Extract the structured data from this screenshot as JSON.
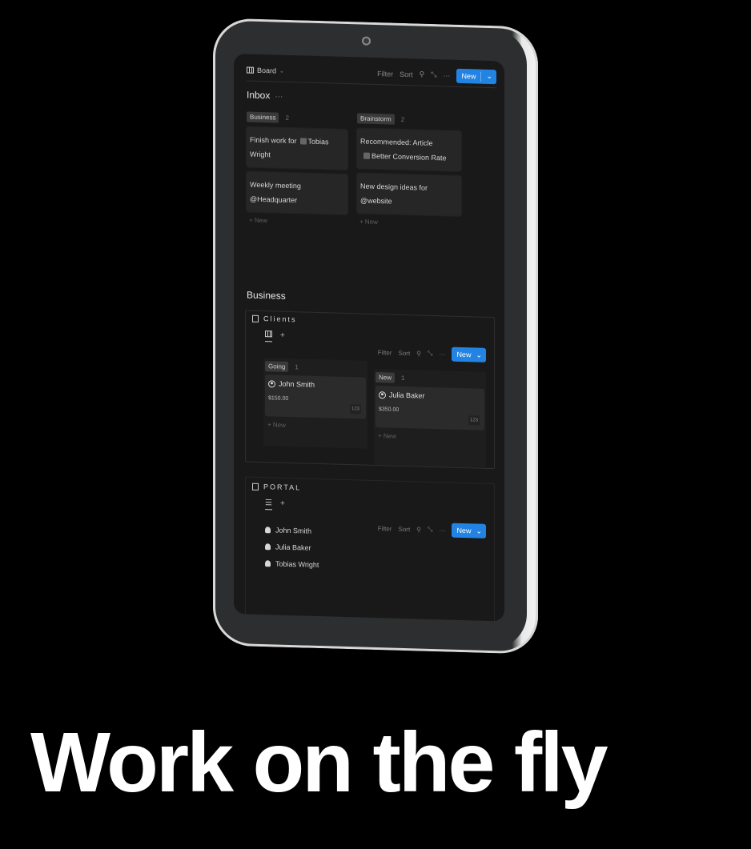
{
  "toolbar": {
    "view_label": "Board",
    "filter": "Filter",
    "sort": "Sort",
    "more": "···",
    "new_label": "New"
  },
  "inbox": {
    "title": "Inbox",
    "more": "···",
    "columns": [
      {
        "tag": "Business",
        "count": "2",
        "cards": [
          {
            "pre": "Finish work for",
            "mention": "Tobias Wright"
          },
          {
            "text": "Weekly meeting @Headquarter"
          }
        ],
        "add": "+ New"
      },
      {
        "tag": "Brainstorm",
        "count": "2",
        "cards": [
          {
            "pre": "Recommended: Article",
            "mention": "Better Conversion Rate"
          },
          {
            "text": "New design ideas for @website"
          }
        ],
        "add": "+ New"
      }
    ]
  },
  "business": {
    "title": "Business",
    "clients": {
      "title": "Clients",
      "add_view": "+",
      "tools": {
        "filter": "Filter",
        "sort": "Sort",
        "more": "···",
        "new_label": "New"
      },
      "columns": [
        {
          "tag": "Going",
          "count": "1",
          "card": {
            "name": "John Smith",
            "amount": "$150.00",
            "num": "123"
          },
          "add": "+ New"
        },
        {
          "tag": "New",
          "count": "1",
          "card": {
            "name": "Julia Baker",
            "amount": "$350.00",
            "num": "123"
          },
          "add": "+ New"
        }
      ]
    },
    "portal": {
      "title": "PORTAL",
      "add_view": "+",
      "tools": {
        "filter": "Filter",
        "sort": "Sort",
        "more": "···",
        "new_label": "New"
      },
      "items": [
        "John Smith",
        "Julia Baker",
        "Tobias Wright"
      ]
    }
  },
  "headline": "Work on the fly"
}
